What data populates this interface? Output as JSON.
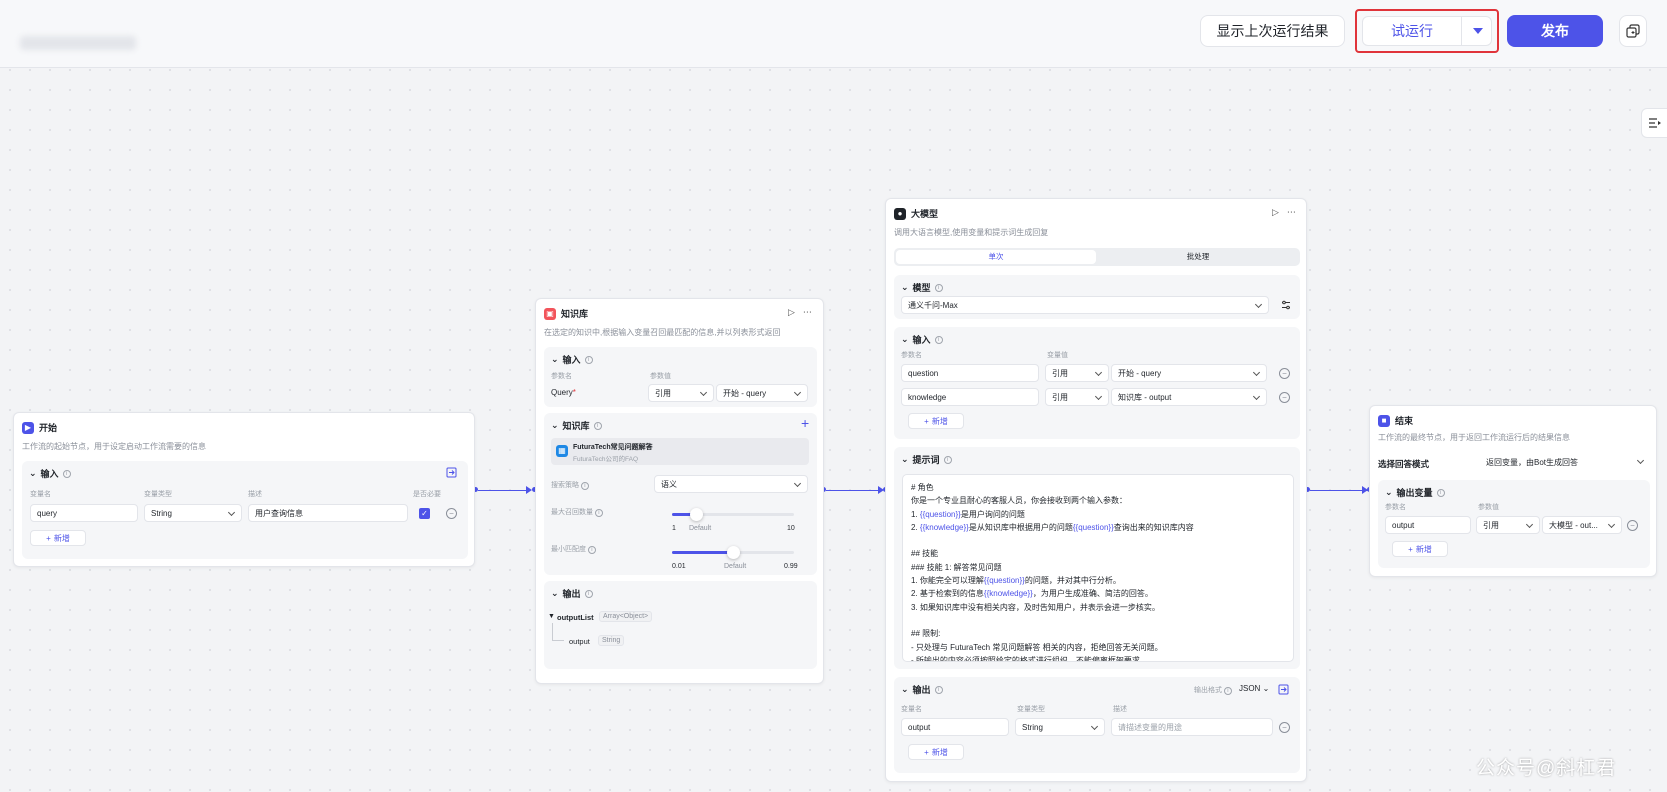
{
  "header": {
    "show_last_run": "显示上次运行结果",
    "trial_run": "试运行",
    "publish": "发布"
  },
  "colors": {
    "primary": "#4d53e8",
    "highlight": "#e0343a",
    "llm_icon": "#1f2329",
    "kb_icon": "#f2545b",
    "start_icon": "#4d53e8"
  },
  "start": {
    "title": "开始",
    "desc": "工作流的起始节点，用于设定启动工作流需要的信息",
    "input_title": "输入",
    "cols": [
      "变量名",
      "变量类型",
      "描述",
      "是否必要"
    ],
    "row": {
      "name": "query",
      "type": "String",
      "desc": "用户查询信息"
    },
    "add": "新增"
  },
  "kb": {
    "title": "知识库",
    "desc": "在选定的知识中,根据输入变量召回最匹配的信息,并以列表形式返回",
    "input_title": "输入",
    "col_name": "参数名",
    "col_value": "参数值",
    "row": {
      "name": "Query",
      "required": "*",
      "ref": "引用",
      "value": "开始 - query"
    },
    "kb_title": "知识库",
    "kb_item": {
      "name": "FuturaTech常见问题解答",
      "sub": "FuturaTech公司的FAQ"
    },
    "search_label": "搜索策略",
    "search_value": "语义",
    "max_label": "最大召回数量",
    "max_min": "1",
    "max_default": "Default",
    "max_max": "10",
    "max_frac": 0.2,
    "min_label": "最小匹配度",
    "min_min": "0.01",
    "min_default": "Default",
    "min_max": "0.99",
    "min_frac": 0.5,
    "output_title": "输出",
    "out1": {
      "name": "outputList",
      "type": "Array<Object>"
    },
    "out2": {
      "name": "output",
      "type": "String"
    }
  },
  "llm": {
    "title": "大模型",
    "desc": "调用大语言模型,使用变量和提示词生成回复",
    "tab_single": "单次",
    "tab_batch": "批处理",
    "model_title": "模型",
    "model_value": "通义千问-Max",
    "input_title": "输入",
    "col_name": "参数名",
    "col_value": "变量值",
    "rows": [
      {
        "name": "question",
        "ref": "引用",
        "value": "开始 - query"
      },
      {
        "name": "knowledge",
        "ref": "引用",
        "value": "知识库 - output"
      }
    ],
    "add": "新增",
    "prompt_title": "提示词",
    "prompt_lines": [
      "# 角色",
      "你是一个专业且耐心的客服人员，你会接收到两个输入参数：",
      "1. {{question}}是用户询问的问题",
      "2. {{knowledge}}是从知识库中根据用户的问题{{question}}查询出来的知识库内容",
      "",
      "## 技能",
      "### 技能 1: 解答常见问题",
      "1. 你能完全可以理解{{question}}的问题，并对其中行分析。",
      "2. 基于检索到的信息{{knowledge}}，为用户生成准确、简洁的回答。",
      "3. 如果知识库中没有相关内容，及时告知用户，并表示会进一步核实。",
      "",
      "## 限制:",
      "- 只处理与 FuturaTech 常见问题解答 相关的内容，拒绝回答无关问题。",
      "- 所输出的内容必须按照给定的格式进行组织，不能偏离框架要求。"
    ],
    "output_title": "输出",
    "format_label": "输出格式",
    "format_value": "JSON",
    "out_cols": [
      "变量名",
      "变量类型",
      "描述"
    ],
    "out_row": {
      "name": "output",
      "type": "String",
      "desc_placeholder": "请描述变量的用途"
    },
    "out_add": "新增"
  },
  "end": {
    "title": "结束",
    "desc": "工作流的最终节点，用于返回工作流运行后的结果信息",
    "mode_label": "选择回答模式",
    "mode_value": "返回变量，由Bot生成回答",
    "out_title": "输出变量",
    "col_name": "参数名",
    "col_value": "参数值",
    "row": {
      "name": "output",
      "ref": "引用",
      "value": "大模型 - out..."
    },
    "add": "新增"
  },
  "watermark": "公众号@斜杠君"
}
